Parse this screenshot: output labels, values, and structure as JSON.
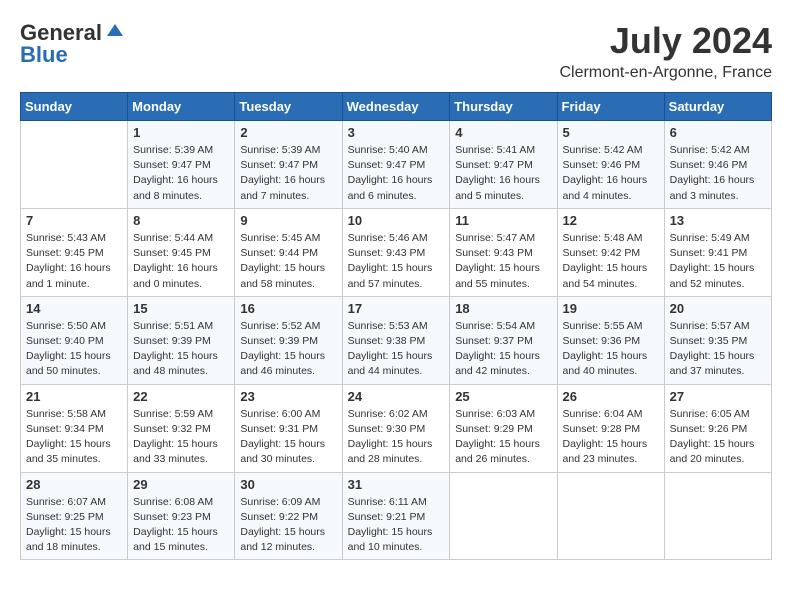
{
  "header": {
    "logo_general": "General",
    "logo_blue": "Blue",
    "month_year": "July 2024",
    "location": "Clermont-en-Argonne, France"
  },
  "weekdays": [
    "Sunday",
    "Monday",
    "Tuesday",
    "Wednesday",
    "Thursday",
    "Friday",
    "Saturday"
  ],
  "weeks": [
    [
      {
        "day": "",
        "info": ""
      },
      {
        "day": "1",
        "info": "Sunrise: 5:39 AM\nSunset: 9:47 PM\nDaylight: 16 hours\nand 8 minutes."
      },
      {
        "day": "2",
        "info": "Sunrise: 5:39 AM\nSunset: 9:47 PM\nDaylight: 16 hours\nand 7 minutes."
      },
      {
        "day": "3",
        "info": "Sunrise: 5:40 AM\nSunset: 9:47 PM\nDaylight: 16 hours\nand 6 minutes."
      },
      {
        "day": "4",
        "info": "Sunrise: 5:41 AM\nSunset: 9:47 PM\nDaylight: 16 hours\nand 5 minutes."
      },
      {
        "day": "5",
        "info": "Sunrise: 5:42 AM\nSunset: 9:46 PM\nDaylight: 16 hours\nand 4 minutes."
      },
      {
        "day": "6",
        "info": "Sunrise: 5:42 AM\nSunset: 9:46 PM\nDaylight: 16 hours\nand 3 minutes."
      }
    ],
    [
      {
        "day": "7",
        "info": "Sunrise: 5:43 AM\nSunset: 9:45 PM\nDaylight: 16 hours\nand 1 minute."
      },
      {
        "day": "8",
        "info": "Sunrise: 5:44 AM\nSunset: 9:45 PM\nDaylight: 16 hours\nand 0 minutes."
      },
      {
        "day": "9",
        "info": "Sunrise: 5:45 AM\nSunset: 9:44 PM\nDaylight: 15 hours\nand 58 minutes."
      },
      {
        "day": "10",
        "info": "Sunrise: 5:46 AM\nSunset: 9:43 PM\nDaylight: 15 hours\nand 57 minutes."
      },
      {
        "day": "11",
        "info": "Sunrise: 5:47 AM\nSunset: 9:43 PM\nDaylight: 15 hours\nand 55 minutes."
      },
      {
        "day": "12",
        "info": "Sunrise: 5:48 AM\nSunset: 9:42 PM\nDaylight: 15 hours\nand 54 minutes."
      },
      {
        "day": "13",
        "info": "Sunrise: 5:49 AM\nSunset: 9:41 PM\nDaylight: 15 hours\nand 52 minutes."
      }
    ],
    [
      {
        "day": "14",
        "info": "Sunrise: 5:50 AM\nSunset: 9:40 PM\nDaylight: 15 hours\nand 50 minutes."
      },
      {
        "day": "15",
        "info": "Sunrise: 5:51 AM\nSunset: 9:39 PM\nDaylight: 15 hours\nand 48 minutes."
      },
      {
        "day": "16",
        "info": "Sunrise: 5:52 AM\nSunset: 9:39 PM\nDaylight: 15 hours\nand 46 minutes."
      },
      {
        "day": "17",
        "info": "Sunrise: 5:53 AM\nSunset: 9:38 PM\nDaylight: 15 hours\nand 44 minutes."
      },
      {
        "day": "18",
        "info": "Sunrise: 5:54 AM\nSunset: 9:37 PM\nDaylight: 15 hours\nand 42 minutes."
      },
      {
        "day": "19",
        "info": "Sunrise: 5:55 AM\nSunset: 9:36 PM\nDaylight: 15 hours\nand 40 minutes."
      },
      {
        "day": "20",
        "info": "Sunrise: 5:57 AM\nSunset: 9:35 PM\nDaylight: 15 hours\nand 37 minutes."
      }
    ],
    [
      {
        "day": "21",
        "info": "Sunrise: 5:58 AM\nSunset: 9:34 PM\nDaylight: 15 hours\nand 35 minutes."
      },
      {
        "day": "22",
        "info": "Sunrise: 5:59 AM\nSunset: 9:32 PM\nDaylight: 15 hours\nand 33 minutes."
      },
      {
        "day": "23",
        "info": "Sunrise: 6:00 AM\nSunset: 9:31 PM\nDaylight: 15 hours\nand 30 minutes."
      },
      {
        "day": "24",
        "info": "Sunrise: 6:02 AM\nSunset: 9:30 PM\nDaylight: 15 hours\nand 28 minutes."
      },
      {
        "day": "25",
        "info": "Sunrise: 6:03 AM\nSunset: 9:29 PM\nDaylight: 15 hours\nand 26 minutes."
      },
      {
        "day": "26",
        "info": "Sunrise: 6:04 AM\nSunset: 9:28 PM\nDaylight: 15 hours\nand 23 minutes."
      },
      {
        "day": "27",
        "info": "Sunrise: 6:05 AM\nSunset: 9:26 PM\nDaylight: 15 hours\nand 20 minutes."
      }
    ],
    [
      {
        "day": "28",
        "info": "Sunrise: 6:07 AM\nSunset: 9:25 PM\nDaylight: 15 hours\nand 18 minutes."
      },
      {
        "day": "29",
        "info": "Sunrise: 6:08 AM\nSunset: 9:23 PM\nDaylight: 15 hours\nand 15 minutes."
      },
      {
        "day": "30",
        "info": "Sunrise: 6:09 AM\nSunset: 9:22 PM\nDaylight: 15 hours\nand 12 minutes."
      },
      {
        "day": "31",
        "info": "Sunrise: 6:11 AM\nSunset: 9:21 PM\nDaylight: 15 hours\nand 10 minutes."
      },
      {
        "day": "",
        "info": ""
      },
      {
        "day": "",
        "info": ""
      },
      {
        "day": "",
        "info": ""
      }
    ]
  ]
}
